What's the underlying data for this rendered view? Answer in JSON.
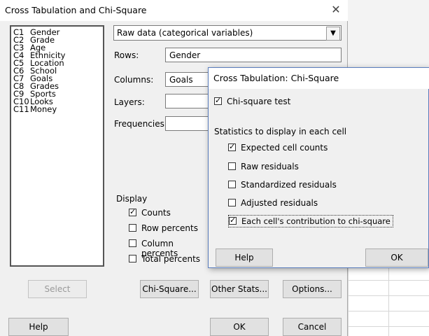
{
  "main": {
    "title": "Cross Tabulation and Chi-Square",
    "variables": [
      {
        "code": "C1",
        "name": "Gender"
      },
      {
        "code": "C2",
        "name": "Grade"
      },
      {
        "code": "C3",
        "name": "Age"
      },
      {
        "code": "C4",
        "name": "Ethnicity"
      },
      {
        "code": "C5",
        "name": "Location"
      },
      {
        "code": "C6",
        "name": "School"
      },
      {
        "code": "C7",
        "name": "Goals"
      },
      {
        "code": "C8",
        "name": "Grades"
      },
      {
        "code": "C9",
        "name": "Sports"
      },
      {
        "code": "C10",
        "name": "Looks"
      },
      {
        "code": "C11",
        "name": "Money"
      }
    ],
    "data_type": "Raw data (categorical variables)",
    "rows_label": "Rows:",
    "rows_value": "Gender",
    "columns_label": "Columns:",
    "columns_value": "Goals",
    "layers_label": "Layers:",
    "frequencies_label": "Frequencies:",
    "display_label": "Display",
    "display": {
      "counts": "Counts",
      "row_percents": "Row percents",
      "column_percents": "Column percents",
      "total_percents": "Total percents"
    },
    "display_checked": {
      "counts": true,
      "row_percents": false,
      "column_percents": false,
      "total_percents": false
    },
    "buttons": {
      "select": "Select",
      "chi_square": "Chi-Square...",
      "other_stats": "Other Stats...",
      "options": "Options...",
      "help": "Help",
      "ok": "OK",
      "cancel": "Cancel"
    }
  },
  "sub": {
    "title": "Cross Tabulation: Chi-Square",
    "chi_square_test": "Chi-square test",
    "chi_square_checked": true,
    "stats_label": "Statistics to display in each cell",
    "stats": {
      "expected": "Expected cell counts",
      "raw": "Raw residuals",
      "standardized": "Standardized residuals",
      "adjusted": "Adjusted residuals",
      "contribution": "Each cell's contribution to chi-square"
    },
    "stats_checked": {
      "expected": true,
      "raw": false,
      "standardized": false,
      "adjusted": false,
      "contribution": true
    },
    "help": "Help",
    "ok": "OK"
  },
  "icons": {
    "close": "close-icon",
    "dropdown": "chevron-down-icon"
  }
}
